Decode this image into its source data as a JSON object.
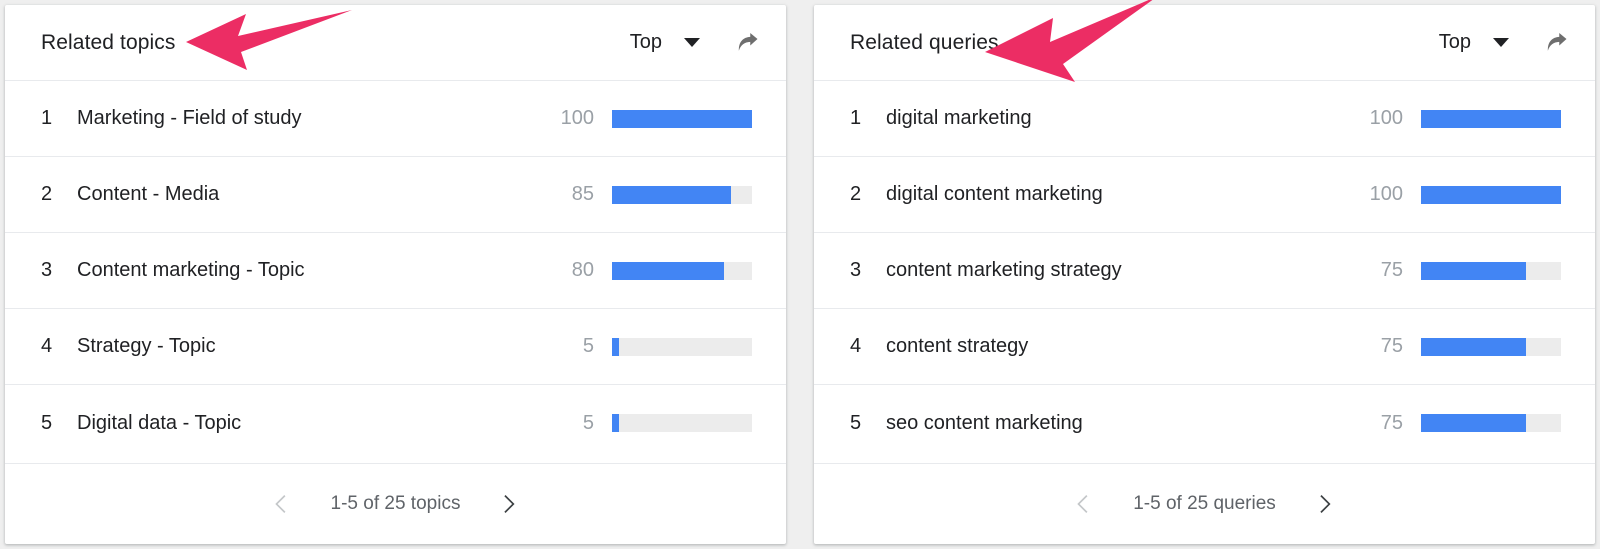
{
  "panels": [
    {
      "title": "Related topics",
      "sort": {
        "label": "Top",
        "caret_icon": "chevron-down-icon"
      },
      "share_icon": "share-arrow-icon",
      "rows": [
        {
          "rank": "1",
          "label": "Marketing - Field of study",
          "value": "100",
          "pct": 100
        },
        {
          "rank": "2",
          "label": "Content - Media",
          "value": "85",
          "pct": 85
        },
        {
          "rank": "3",
          "label": "Content marketing - Topic",
          "value": "80",
          "pct": 80
        },
        {
          "rank": "4",
          "label": "Strategy - Topic",
          "value": "5",
          "pct": 5
        },
        {
          "rank": "5",
          "label": "Digital data - Topic",
          "value": "5",
          "pct": 5
        }
      ],
      "pagination": {
        "prev_icon": "chevron-left-icon",
        "next_icon": "chevron-right-icon",
        "text": "1-5 of 25 topics",
        "prev_enabled": false,
        "next_enabled": true
      }
    },
    {
      "title": "Related queries",
      "sort": {
        "label": "Top",
        "caret_icon": "chevron-down-icon"
      },
      "share_icon": "share-arrow-icon",
      "rows": [
        {
          "rank": "1",
          "label": "digital marketing",
          "value": "100",
          "pct": 100
        },
        {
          "rank": "2",
          "label": "digital content marketing",
          "value": "100",
          "pct": 100
        },
        {
          "rank": "3",
          "label": "content marketing strategy",
          "value": "75",
          "pct": 75
        },
        {
          "rank": "4",
          "label": "content strategy",
          "value": "75",
          "pct": 75
        },
        {
          "rank": "5",
          "label": "seo content marketing",
          "value": "75",
          "pct": 75
        }
      ],
      "pagination": {
        "prev_icon": "chevron-left-icon",
        "next_icon": "chevron-right-icon",
        "text": "1-5 of 25 queries",
        "prev_enabled": false,
        "next_enabled": true
      }
    }
  ],
  "annotations": [
    {
      "name": "arrow-pointing-to-related-topics",
      "color": "#EC2D64"
    },
    {
      "name": "arrow-pointing-to-related-queries",
      "color": "#EC2D64"
    }
  ],
  "colors": {
    "bar_fill": "#4285f4",
    "bar_track": "#ececec",
    "text_primary": "#202124",
    "text_muted": "#9aa0a6",
    "annotation_pink": "#EC2D64",
    "page_background": "#efefef"
  }
}
